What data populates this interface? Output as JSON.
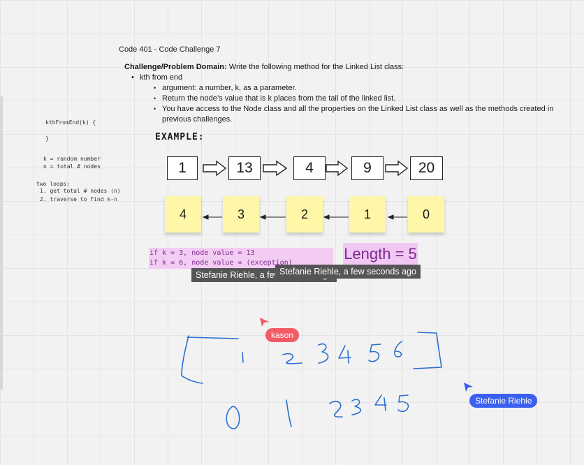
{
  "colors": {
    "kason": "#f25a64",
    "stefanie": "#3b60f0",
    "ink": "#2a6fd1",
    "sticky": "#fff7a8",
    "note": "#f3ccf3"
  },
  "board": {
    "title": "Code 401 - Code Challenge 7",
    "problem": {
      "heading": "Challenge/Problem Domain:",
      "intro": " Write the following method for the Linked List class:",
      "method": "kth from end",
      "details": [
        "argument: a number, k, as a parameter.",
        "Return the node’s value that is k places from the tail of the linked list.",
        "You have access to the Node class and all the properties on the Linked List class as well as the methods created in previous challenges."
      ]
    },
    "pseudo": {
      "signature": "kthFromEnd(k) {",
      "close": "}",
      "vars": [
        "k = random number",
        "n = total # nodes"
      ],
      "loops_title": "two loops:",
      "loops": [
        "1. get total # nodes (n)",
        "2. traverse to find k-n"
      ]
    },
    "example_label": "EXAMPLE:",
    "nodes": [
      "1",
      "13",
      "4",
      "9",
      "20"
    ],
    "indices": [
      "4",
      "3",
      "2",
      "1",
      "0"
    ],
    "code_note": [
      "if k = 3, node value = 13",
      "if k = 6, node value = (exception)"
    ],
    "length_label": "Length = 5",
    "tooltips": [
      "Stefanie Riehle, a few seconds ago",
      "Stefanie Riehle, a few seconds ago"
    ],
    "cursors": {
      "kason": "kason",
      "stefanie": "Stefanie Riehle"
    }
  }
}
